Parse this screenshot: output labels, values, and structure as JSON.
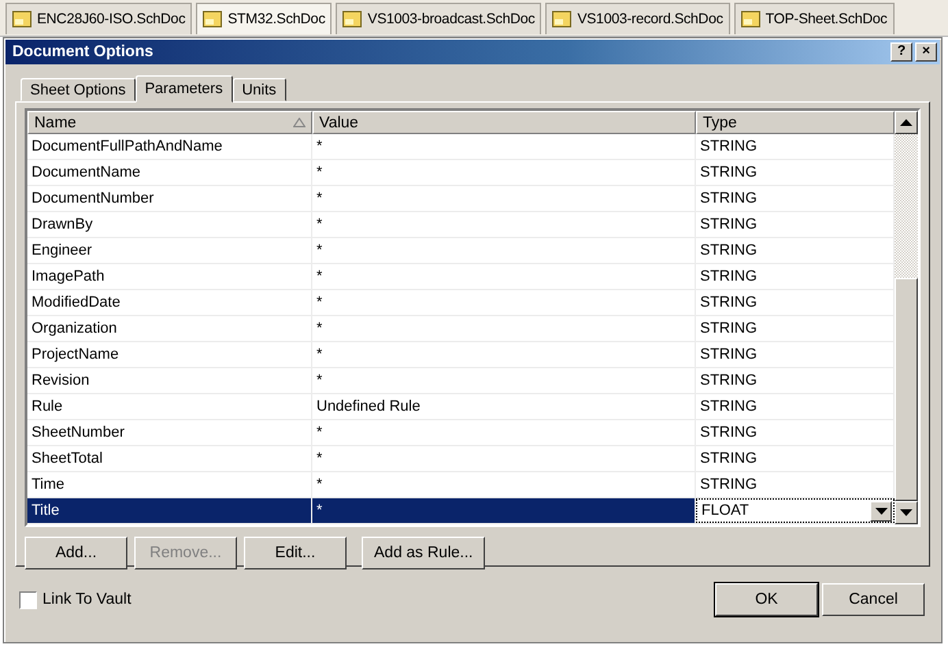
{
  "doc_tabs": [
    {
      "label": "ENC28J60-ISO.SchDoc",
      "selected": false
    },
    {
      "label": "STM32.SchDoc",
      "selected": true
    },
    {
      "label": "VS1003-broadcast.SchDoc",
      "selected": false
    },
    {
      "label": "VS1003-record.SchDoc",
      "selected": false
    },
    {
      "label": "TOP-Sheet.SchDoc",
      "selected": false
    }
  ],
  "window": {
    "title": "Document Options",
    "help": "?",
    "close": "×"
  },
  "tabs": [
    {
      "label": "Sheet Options",
      "selected": false
    },
    {
      "label": "Parameters",
      "selected": true
    },
    {
      "label": "Units",
      "selected": false
    }
  ],
  "table": {
    "columns": [
      "Name",
      "Value",
      "Type"
    ],
    "rows": [
      {
        "name": "DocumentFullPathAndName",
        "value": "*",
        "type": "STRING",
        "selected": false
      },
      {
        "name": "DocumentName",
        "value": "*",
        "type": "STRING",
        "selected": false
      },
      {
        "name": "DocumentNumber",
        "value": "*",
        "type": "STRING",
        "selected": false
      },
      {
        "name": "DrawnBy",
        "value": "*",
        "type": "STRING",
        "selected": false
      },
      {
        "name": "Engineer",
        "value": "*",
        "type": "STRING",
        "selected": false
      },
      {
        "name": "ImagePath",
        "value": "*",
        "type": "STRING",
        "selected": false
      },
      {
        "name": "ModifiedDate",
        "value": "*",
        "type": "STRING",
        "selected": false
      },
      {
        "name": "Organization",
        "value": "*",
        "type": "STRING",
        "selected": false
      },
      {
        "name": "ProjectName",
        "value": "*",
        "type": "STRING",
        "selected": false
      },
      {
        "name": "Revision",
        "value": "*",
        "type": "STRING",
        "selected": false
      },
      {
        "name": "Rule",
        "value": "Undefined Rule",
        "type": "STRING",
        "selected": false
      },
      {
        "name": "SheetNumber",
        "value": "*",
        "type": "STRING",
        "selected": false
      },
      {
        "name": "SheetTotal",
        "value": "*",
        "type": "STRING",
        "selected": false
      },
      {
        "name": "Time",
        "value": "*",
        "type": "STRING",
        "selected": false
      },
      {
        "name": "Title",
        "value": "*",
        "type": "FLOAT",
        "selected": true
      }
    ]
  },
  "buttons": [
    {
      "label": "Add...",
      "disabled": false
    },
    {
      "label": "Remove...",
      "disabled": true
    },
    {
      "label": "Edit...",
      "disabled": false
    },
    {
      "label": "Add as Rule...",
      "disabled": false
    }
  ],
  "link_to_vault": {
    "label": "Link To Vault",
    "checked": false
  },
  "dialog_buttons": [
    {
      "label": "OK",
      "default": true
    },
    {
      "label": "Cancel",
      "default": false
    }
  ]
}
